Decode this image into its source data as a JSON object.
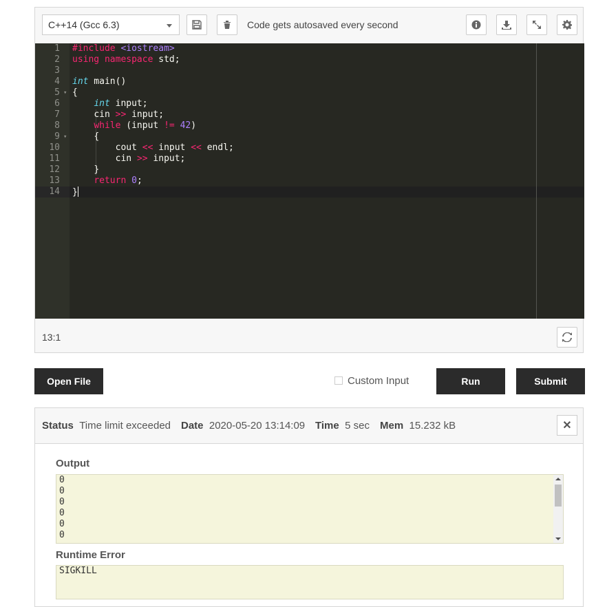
{
  "editor": {
    "language": "C++14 (Gcc 6.3)",
    "autosave_text": "Code gets autosaved every second",
    "icons": {
      "save": "save-icon",
      "delete": "trash-icon",
      "info": "info-icon",
      "download": "download-icon",
      "fullscreen": "expand-icon",
      "settings": "gear-icon",
      "refresh": "refresh-icon"
    },
    "cursor_position": "13:1",
    "lines": [
      {
        "n": "1",
        "fold": ""
      },
      {
        "n": "2",
        "fold": ""
      },
      {
        "n": "3",
        "fold": ""
      },
      {
        "n": "4",
        "fold": ""
      },
      {
        "n": "5",
        "fold": "▾"
      },
      {
        "n": "6",
        "fold": ""
      },
      {
        "n": "7",
        "fold": ""
      },
      {
        "n": "8",
        "fold": ""
      },
      {
        "n": "9",
        "fold": "▾"
      },
      {
        "n": "10",
        "fold": ""
      },
      {
        "n": "11",
        "fold": ""
      },
      {
        "n": "12",
        "fold": ""
      },
      {
        "n": "13",
        "fold": ""
      },
      {
        "n": "14",
        "fold": ""
      }
    ],
    "code": {
      "l1_include": "#include",
      "l1_header": "<iostream>",
      "l2_using": "using",
      "l2_namespace": "namespace",
      "l2_rest": " std;",
      "l4_int": "int",
      "l4_rest": " main()",
      "l5": "{",
      "l6_int": "int",
      "l6_rest": " input;",
      "l7_a": "cin ",
      "l7_op": ">>",
      "l7_b": " input;",
      "l8_while": "while",
      "l8_a": " (input ",
      "l8_op": "!=",
      "l8_b": " ",
      "l8_num": "42",
      "l8_c": ")",
      "l9": "{",
      "l10_a": "cout ",
      "l10_op1": "<<",
      "l10_b": " input ",
      "l10_op2": "<<",
      "l10_c": " endl;",
      "l11_a": "cin ",
      "l11_op": ">>",
      "l11_b": " input;",
      "l12": "}",
      "l13_return": "return",
      "l13_a": " ",
      "l13_num": "0",
      "l13_b": ";",
      "l14": "}"
    },
    "colors": {
      "background": "#272822",
      "keyword": "#f92672",
      "type": "#66d9ef",
      "number": "#ae81ff"
    }
  },
  "actions": {
    "open_file": "Open File",
    "custom_input": "Custom Input",
    "run": "Run",
    "submit": "Submit"
  },
  "result": {
    "status_label": "Status",
    "status_value": "Time limit exceeded",
    "date_label": "Date",
    "date_value": "2020-05-20 13:14:09",
    "time_label": "Time",
    "time_value": "5 sec",
    "mem_label": "Mem",
    "mem_value": "15.232 kB",
    "close_icon": "close-icon",
    "output_label": "Output",
    "output_lines": [
      "0",
      "0",
      "0",
      "0",
      "0",
      "0"
    ],
    "runtime_error_label": "Runtime Error",
    "runtime_error_value": "SIGKILL"
  }
}
